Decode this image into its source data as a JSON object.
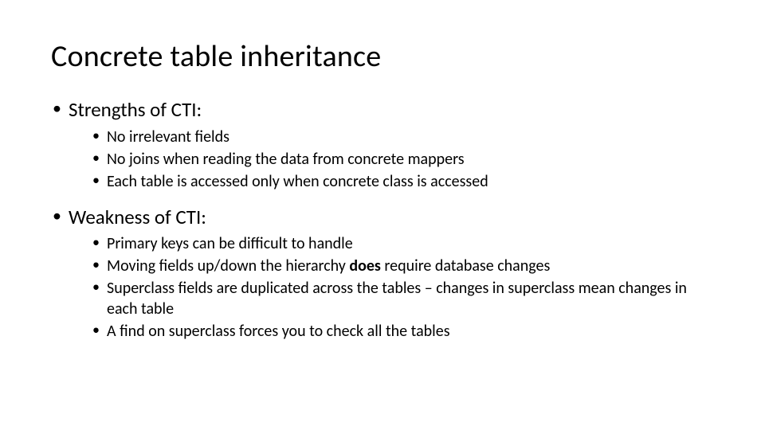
{
  "title": "Concrete table inheritance",
  "sections": [
    {
      "heading": "Strengths of CTI:",
      "items": [
        {
          "text": "No irrelevant fields"
        },
        {
          "text": "No joins when reading the data from concrete mappers"
        },
        {
          "text": "Each table is accessed only when concrete class is accessed"
        }
      ]
    },
    {
      "heading": "Weakness of CTI:",
      "items": [
        {
          "text": "Primary keys can be difficult to handle"
        },
        {
          "pre": "Moving fields up/down the hierarchy ",
          "bold": "does",
          "post": " require database changes"
        },
        {
          "text": "Superclass fields are duplicated across the tables – changes in superclass mean changes in each table"
        },
        {
          "text": "A find on superclass forces you to check all the tables"
        }
      ]
    }
  ]
}
